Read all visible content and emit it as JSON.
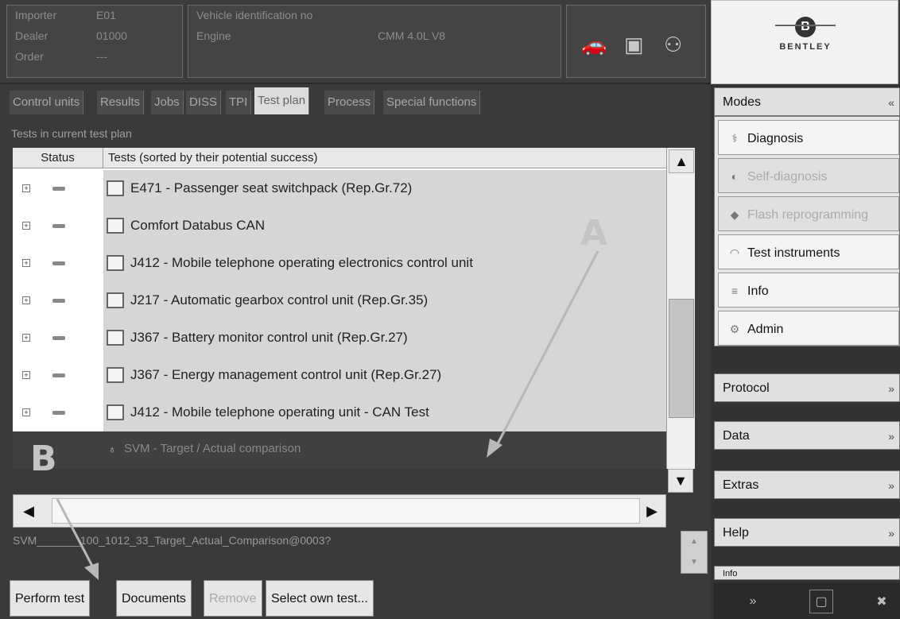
{
  "header": {
    "importer_label": "Importer",
    "importer_value": "E01",
    "dealer_label": "Dealer",
    "dealer_value": "01000",
    "order_label": "Order",
    "order_value": "---",
    "vin_label": "Vehicle identification no",
    "engine_label": "Engine",
    "engine_value": "CMM 4.0L V8",
    "icons": [
      "car-icon",
      "network-icon",
      "plug-icon"
    ],
    "logo_text": "BENTLEY",
    "logo_mark": "B"
  },
  "tabs": [
    {
      "label": "Control units",
      "active": false
    },
    {
      "label": "Results",
      "active": false
    },
    {
      "label": "Jobs",
      "active": false
    },
    {
      "label": "DISS",
      "active": false
    },
    {
      "label": "TPI",
      "active": false
    },
    {
      "label": "Test plan",
      "active": true
    },
    {
      "label": "Process",
      "active": false
    },
    {
      "label": "Special functions",
      "active": false
    }
  ],
  "current_plan_label": "Tests in current test plan",
  "table": {
    "columns": [
      "Status",
      "Tests (sorted by their potential success)"
    ],
    "rows": [
      "E471 - Passenger seat switchpack (Rep.Gr.72)",
      "Comfort Databus CAN",
      "J412 - Mobile telephone operating electronics control unit",
      "J217 - Automatic gearbox control unit (Rep.Gr.35)",
      "J367 - Battery monitor control unit (Rep.Gr.27)",
      "J367 - Energy management control unit (Rep.Gr.27)",
      "J412 - Mobile telephone operating unit - CAN Test"
    ],
    "selected_row": "SVM - Target / Actual comparison"
  },
  "annotations": {
    "a": "A",
    "b": "B"
  },
  "status_line": "SVM_______100_1012_33_Target_Actual_Comparison@0003?",
  "buttons": {
    "perform_test": "Perform test",
    "documents": "Documents",
    "remove": "Remove",
    "select_own_test": "Select own test..."
  },
  "right_panel": {
    "modes_label": "Modes",
    "modes": [
      {
        "label": "Diagnosis",
        "icon": "stethoscope-icon",
        "enabled": true
      },
      {
        "label": "Self-diagnosis",
        "icon": "car-diag-icon",
        "enabled": false
      },
      {
        "label": "Flash reprogramming",
        "icon": "flash-icon",
        "enabled": false
      },
      {
        "label": "Test instruments",
        "icon": "meter-icon",
        "enabled": true
      },
      {
        "label": "Info",
        "icon": "info-icon",
        "enabled": true
      },
      {
        "label": "Admin",
        "icon": "admin-icon",
        "enabled": true
      }
    ],
    "sections": [
      "Protocol",
      "Data",
      "Extras",
      "Help",
      "Info"
    ],
    "collapse_chevron": "«",
    "expand_chevron": "»"
  }
}
